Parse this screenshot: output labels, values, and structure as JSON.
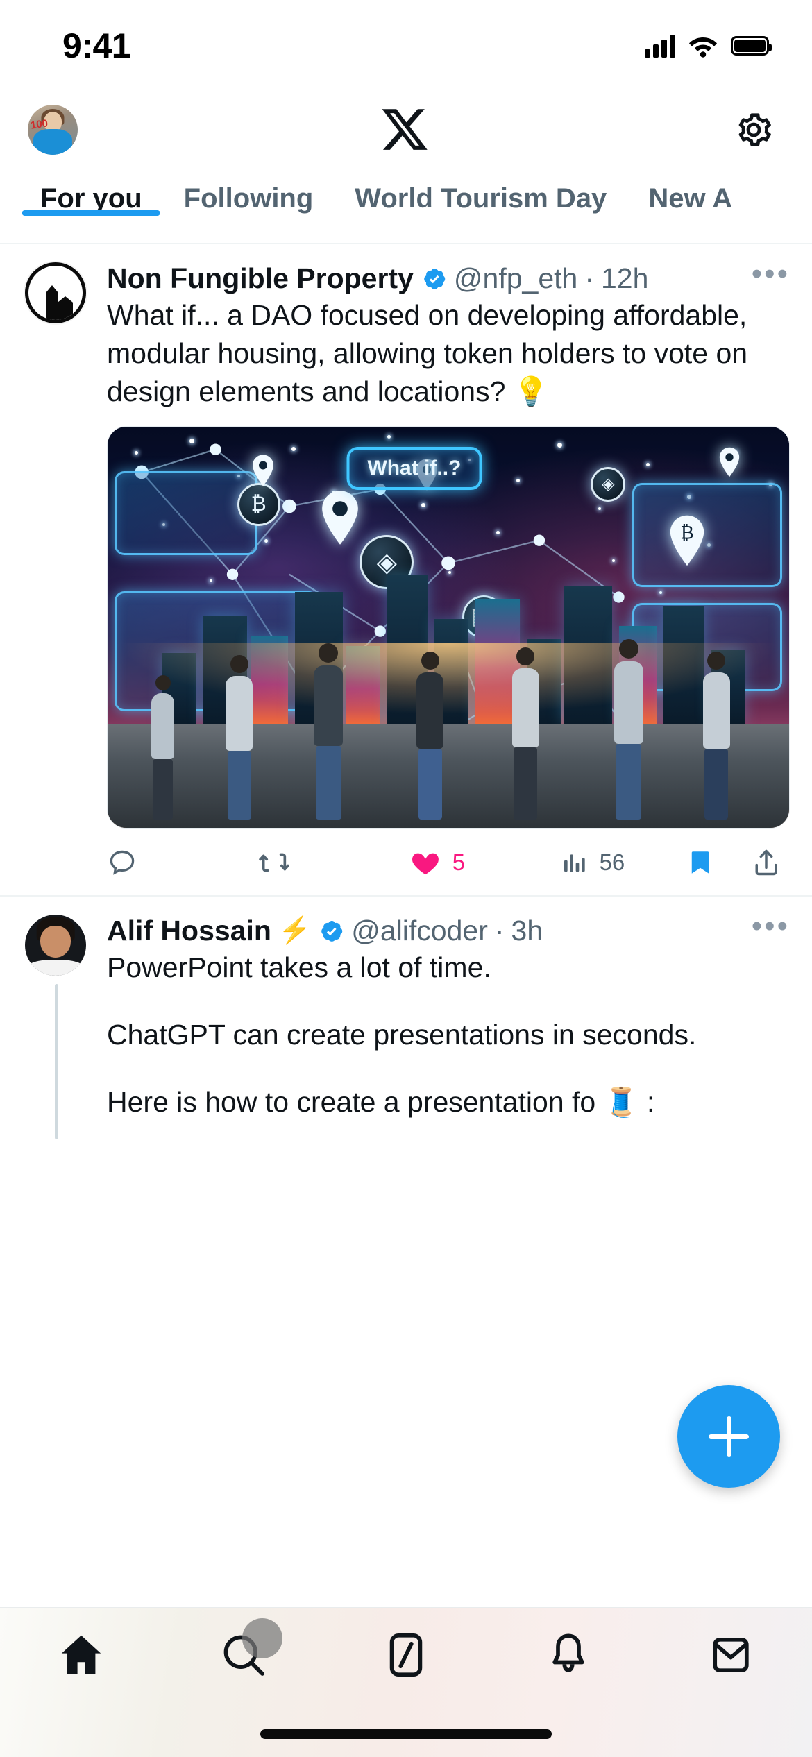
{
  "status_bar": {
    "time": "9:41",
    "icons": [
      "signal-icon",
      "wifi-icon",
      "battery-icon"
    ]
  },
  "header": {
    "avatar_name": "profile-avatar",
    "logo": "x-logo",
    "settings": "gear-icon"
  },
  "tabs": [
    {
      "label": "For you",
      "active": true
    },
    {
      "label": "Following",
      "active": false
    },
    {
      "label": "World Tourism Day",
      "active": false
    },
    {
      "label": "New A",
      "active": false
    }
  ],
  "tweets": [
    {
      "display_name": "Non Fungible Property",
      "verified": true,
      "handle": "@nfp_eth",
      "separator": "·",
      "time": "12h",
      "more": "•••",
      "text": "What if... a DAO focused on developing affordable, modular housing, allowing token holders to vote on design elements and locations? 💡",
      "media": {
        "alt": "futuristic-city-illustration",
        "badge_text": "What if..?"
      },
      "actions": {
        "reply_count": "",
        "retweet_count": "",
        "like_count": "5",
        "view_count": "56",
        "bookmarked": true,
        "share": "share-icon"
      }
    },
    {
      "display_name": "Alif Hossain",
      "name_emoji": "⚡",
      "verified": true,
      "handle": "@alifcoder",
      "separator": "·",
      "time": "3h",
      "more": "•••",
      "paragraphs": [
        "PowerPoint takes a lot of time.",
        "ChatGPT can create presentations in seconds.",
        "Here is how to create a presentation fo 🧵 :"
      ]
    }
  ],
  "fab": {
    "label": "+",
    "name": "compose-button"
  },
  "bottom_nav": [
    {
      "name": "nav-home",
      "icon": "home-icon",
      "active": true
    },
    {
      "name": "nav-search",
      "icon": "search-icon",
      "active": false
    },
    {
      "name": "nav-grok",
      "icon": "grok-icon",
      "active": false
    },
    {
      "name": "nav-notifications",
      "icon": "bell-icon",
      "active": false
    },
    {
      "name": "nav-messages",
      "icon": "mail-icon",
      "active": false
    }
  ],
  "colors": {
    "accent": "#1d9bf0",
    "like": "#f91880",
    "text": "#0f1419",
    "muted": "#536471",
    "border": "#eff3f4"
  }
}
